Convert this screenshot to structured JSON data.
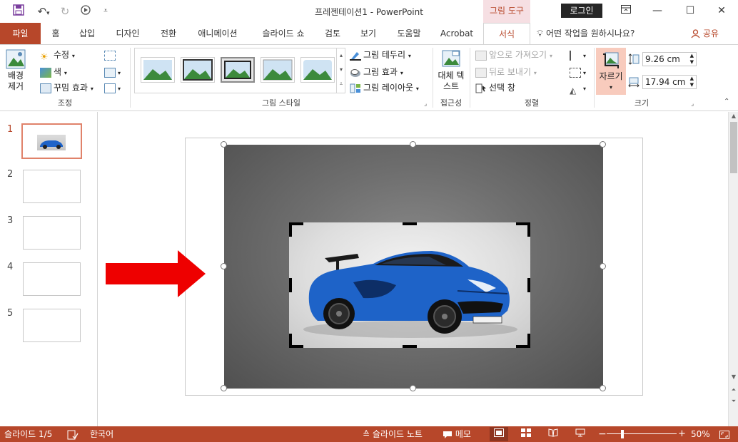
{
  "window": {
    "title": "프레젠테이션1 - PowerPoint",
    "context_tab": "그림 도구",
    "login_label": "로그인"
  },
  "tabs": {
    "file": "파일",
    "home": "홈",
    "insert": "삽입",
    "design": "디자인",
    "transitions": "전환",
    "animations": "애니메이션",
    "slideshow": "슬라이드 쇼",
    "review": "검토",
    "view": "보기",
    "help": "도움말",
    "acrobat": "Acrobat",
    "format": "서식",
    "search": "어떤 작업을 원하시나요?",
    "share": "공유"
  },
  "ribbon": {
    "adjust": {
      "remove_bg": "배경 제거",
      "corrections": "수정",
      "color": "색",
      "artistic": "꾸밈 효과",
      "label": "조정"
    },
    "styles": {
      "border": "그림 테두리",
      "effects": "그림 효과",
      "layout": "그림 레이아웃",
      "label": "그림 스타일"
    },
    "accessibility": {
      "alt_text": "대체 텍스트",
      "label": "접근성"
    },
    "arrange": {
      "bring_forward": "앞으로 가져오기",
      "send_backward": "뒤로 보내기",
      "selection_pane": "선택 창",
      "label": "정렬"
    },
    "size": {
      "crop": "자르기",
      "height": "9.26 cm",
      "width": "17.94 cm",
      "label": "크기"
    }
  },
  "slides": [
    "1",
    "2",
    "3",
    "4",
    "5"
  ],
  "status": {
    "slide_count": "슬라이드 1/5",
    "language": "한국어",
    "notes": "슬라이드 노트",
    "comments": "메모",
    "zoom": "50%"
  },
  "colors": {
    "accent": "#b7472a",
    "arrow": "#ee0000"
  }
}
